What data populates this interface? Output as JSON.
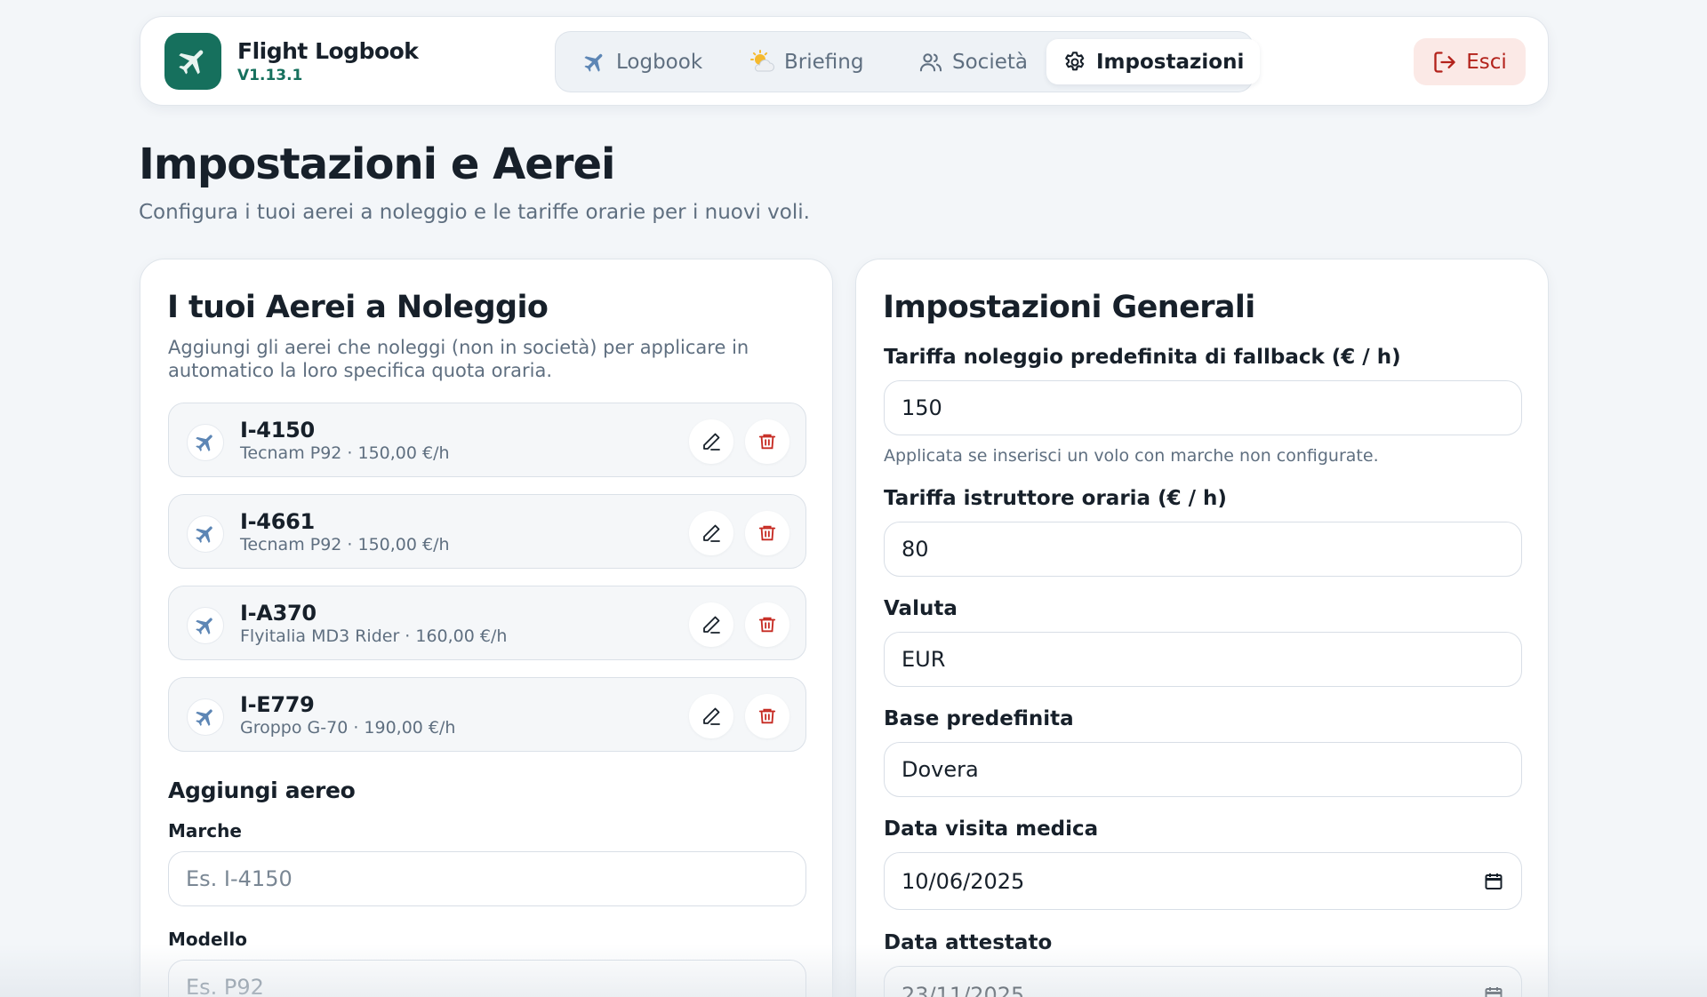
{
  "app": {
    "title": "Flight Logbook",
    "version": "V1.13.1",
    "brand_color": "#16705d"
  },
  "nav": {
    "tabs": [
      {
        "label": "Logbook",
        "icon": "airplane-icon",
        "active": false
      },
      {
        "label": "Briefing",
        "icon": "sun-cloud-icon",
        "active": false
      },
      {
        "label": "Società",
        "icon": "users-icon",
        "active": false
      },
      {
        "label": "Impostazioni",
        "icon": "gear-icon",
        "active": true
      }
    ],
    "logout_label": "Esci",
    "logout_color": "#b3221b"
  },
  "page": {
    "title": "Impostazioni e Aerei",
    "subtitle": "Configura i tuoi aerei a noleggio e le tariffe orarie per i nuovi voli."
  },
  "aircraft": {
    "title": "I tuoi Aerei a Noleggio",
    "description": "Aggiungi gli aerei che noleggi (non in società) per applicare in automatico la loro specifica quota oraria.",
    "items": [
      {
        "registration": "I-4150",
        "details": "Tecnam P92 · 150,00 €/h"
      },
      {
        "registration": "I-4661",
        "details": "Tecnam P92 · 150,00 €/h"
      },
      {
        "registration": "I-A370",
        "details": "Flyitalia MD3 Rider · 160,00 €/h"
      },
      {
        "registration": "I-E779",
        "details": "Groppo G-70 · 190,00 €/h"
      }
    ],
    "add_form": {
      "title": "Aggiungi aereo",
      "registration_label": "Marche",
      "registration_placeholder": "Es. I-4150",
      "model_label": "Modello",
      "model_placeholder": "Es. P92"
    }
  },
  "general": {
    "title": "Impostazioni Generali",
    "fallback_rate_label": "Tariffa noleggio predefinita di fallback (€ / h)",
    "fallback_rate_value": "150",
    "fallback_rate_hint": "Applicata se inserisci un volo con marche non configurate.",
    "instructor_rate_label": "Tariffa istruttore oraria (€ / h)",
    "instructor_rate_value": "80",
    "currency_label": "Valuta",
    "currency_value": "EUR",
    "base_label": "Base predefinita",
    "base_value": "Dovera",
    "medical_date_label": "Data visita medica",
    "medical_date_value": "10/06/2025",
    "certificate_date_label": "Data attestato",
    "certificate_date_value": "23/11/2025"
  }
}
